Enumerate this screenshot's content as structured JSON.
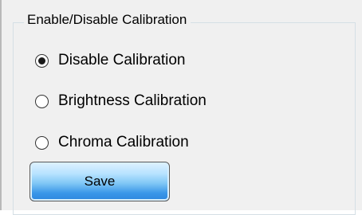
{
  "group": {
    "title": "Enable/Disable Calibration"
  },
  "options": [
    {
      "label": "Disable Calibration",
      "selected": true
    },
    {
      "label": "Brightness Calibration",
      "selected": false
    },
    {
      "label": "Chroma Calibration",
      "selected": false
    }
  ],
  "save_button": {
    "label": "Save"
  },
  "colors": {
    "button_top": "#dff2ff",
    "button_bottom": "#2d86de",
    "panel_background": "#f0f0f0",
    "group_border": "#d5dfe5"
  }
}
